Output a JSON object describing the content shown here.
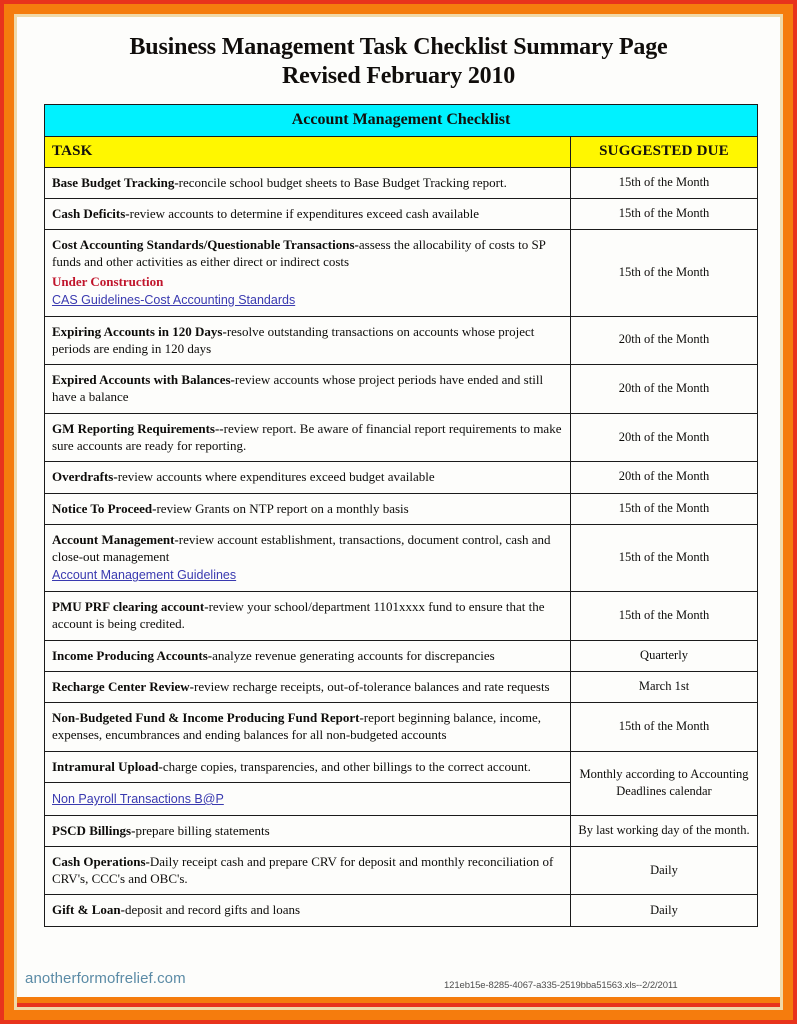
{
  "document": {
    "title_line1": "Business Management Task Checklist Summary Page",
    "title_line2": "Revised February 2010"
  },
  "table": {
    "banner": "Account Management Checklist",
    "headers": {
      "task": "TASK",
      "due": "SUGGESTED DUE"
    },
    "rows": [
      {
        "lead": "Base Budget Tracking-",
        "body": "reconcile school budget sheets to Base Budget Tracking report.",
        "due": "15th of the Month"
      },
      {
        "lead": "Cash Deficits-",
        "body": "review accounts to determine if expenditures exceed cash available",
        "due": "15th of the Month"
      },
      {
        "lead": "Cost Accounting Standards/Questionable Transactions-",
        "body": "assess the allocability of costs to SP funds and other activities as either direct or indirect costs",
        "note": "Under Construction",
        "link": "CAS Guidelines-Cost Accounting Standards",
        "due": "15th of the Month"
      },
      {
        "lead": "Expiring Accounts in 120 Days-",
        "body": "resolve outstanding transactions on accounts whose project periods are ending in 120 days",
        "due": "20th of the Month"
      },
      {
        "lead": "Expired Accounts with Balances-",
        "body": "review accounts whose project periods have ended and still have a balance",
        "due": "20th of the Month"
      },
      {
        "lead": "GM Reporting Requirements--",
        "body": "review report.  Be aware of financial report requirements to make sure accounts are ready for reporting.",
        "due": "20th of the Month"
      },
      {
        "lead": "Overdrafts-",
        "body": "review accounts where expenditures exceed budget available",
        "due": "20th of the Month"
      },
      {
        "lead": "Notice To Proceed-",
        "body": "review Grants on NTP report on a monthly basis",
        "due": "15th of the Month"
      },
      {
        "lead": "Account Management-",
        "body": "review account establishment, transactions, document control, cash and close-out management",
        "link": "Account Management Guidelines",
        "due": "15th of the Month"
      },
      {
        "lead": "PMU PRF clearing account-",
        "body": "review your school/department 1101xxxx fund to ensure that the account is being credited.",
        "due": "15th of the Month"
      },
      {
        "lead": "Income Producing Accounts-",
        "body": "analyze revenue generating accounts for discrepancies",
        "due": "Quarterly"
      },
      {
        "lead": "Recharge Center Review-",
        "body": "review recharge receipts, out-of-tolerance balances and rate requests",
        "due": "March 1st"
      },
      {
        "lead": "Non-Budgeted Fund & Income Producing Fund Report-",
        "body": "report beginning balance, income, expenses, encumbrances and ending balances for all non-budgeted accounts",
        "due": "15th of the Month"
      },
      {
        "lead": "Intramural Upload-",
        "body": "charge copies, transparencies, and other billings to the correct account.",
        "due": "Monthly according to Accounting Deadlines calendar"
      },
      {
        "link_only": "Non Payroll Transactions B@P"
      },
      {
        "lead": "PSCD Billings-",
        "body": "prepare billing statements",
        "due": "By last working day of the month."
      },
      {
        "lead": "Cash Operations-",
        "body": "Daily receipt cash and prepare CRV for deposit and monthly reconciliation of CRV's, CCC's  and OBC's.",
        "due": "Daily"
      },
      {
        "lead": "Gift & Loan-",
        "body": "deposit and record gifts and loans",
        "due": "Daily"
      }
    ]
  },
  "footer": {
    "watermark": "anotherformofrelief.com",
    "file_stamp": "121eb15e-8285-4067-a335-2519bba51563.xls--2/2/2011"
  },
  "colors": {
    "banner_bg": "#00f2ff",
    "header_bg": "#fff700",
    "frame_red": "#e8331c",
    "frame_orange": "#f57c0d",
    "link": "#3a3ab0",
    "warning": "#c0142b"
  }
}
